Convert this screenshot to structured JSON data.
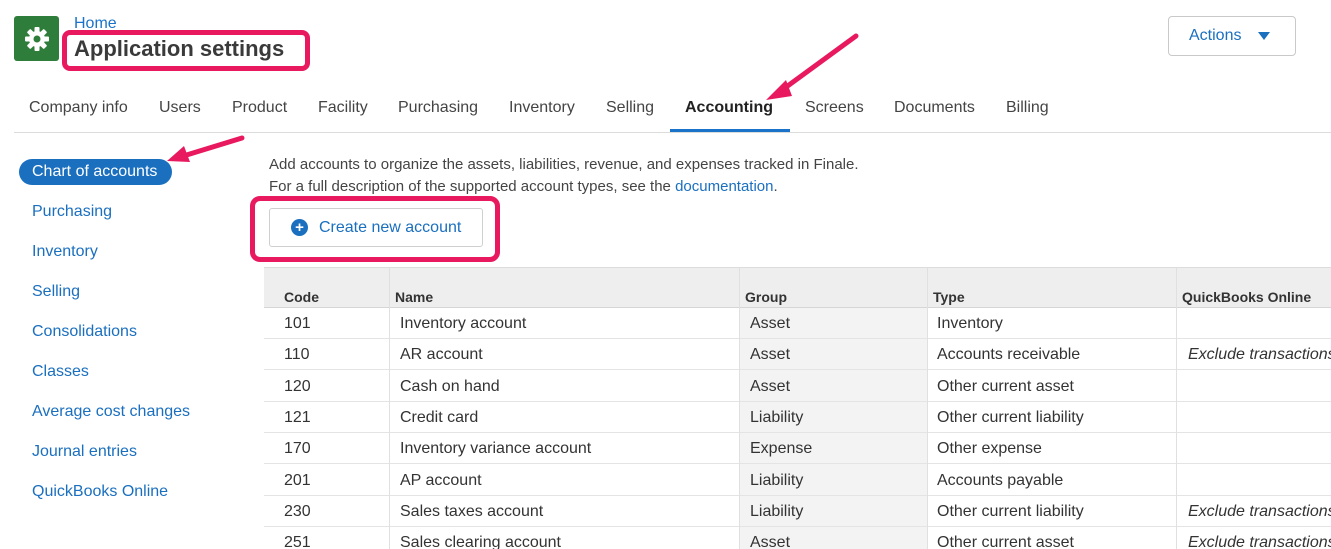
{
  "header": {
    "breadcrumb": "Home",
    "title": "Application settings",
    "actions_label": "Actions"
  },
  "tabs": [
    {
      "label": "Company info"
    },
    {
      "label": "Users"
    },
    {
      "label": "Product"
    },
    {
      "label": "Facility"
    },
    {
      "label": "Purchasing"
    },
    {
      "label": "Inventory"
    },
    {
      "label": "Selling"
    },
    {
      "label": "Accounting",
      "active": true
    },
    {
      "label": "Screens"
    },
    {
      "label": "Documents"
    },
    {
      "label": "Billing"
    }
  ],
  "sidebar": {
    "items": [
      {
        "label": "Chart of accounts",
        "active": true
      },
      {
        "label": "Purchasing"
      },
      {
        "label": "Inventory"
      },
      {
        "label": "Selling"
      },
      {
        "label": "Consolidations"
      },
      {
        "label": "Classes"
      },
      {
        "label": "Average cost changes"
      },
      {
        "label": "Journal entries"
      },
      {
        "label": "QuickBooks Online"
      }
    ]
  },
  "main": {
    "description_line1": "Add accounts to organize the assets, liabilities, revenue, and expenses tracked in Finale.",
    "description_line2_prefix": "For a full description of the supported account types, see the",
    "description_link": "documentation",
    "description_line2_suffix": ".",
    "create_button_label": "Create new account"
  },
  "table": {
    "columns": [
      "Code",
      "Name",
      "Group",
      "Type",
      "QuickBooks Online"
    ],
    "rows": [
      {
        "code": "101",
        "name": "Inventory account",
        "group": "Asset",
        "type": "Inventory",
        "qbo": ""
      },
      {
        "code": "110",
        "name": "AR account",
        "group": "Asset",
        "type": "Accounts receivable",
        "qbo": "Exclude transactions"
      },
      {
        "code": "120",
        "name": "Cash on hand",
        "group": "Asset",
        "type": "Other current asset",
        "qbo": ""
      },
      {
        "code": "121",
        "name": "Credit card",
        "group": "Liability",
        "type": "Other current liability",
        "qbo": ""
      },
      {
        "code": "170",
        "name": "Inventory variance account",
        "group": "Expense",
        "type": "Other expense",
        "qbo": ""
      },
      {
        "code": "201",
        "name": "AP account",
        "group": "Liability",
        "type": "Accounts payable",
        "qbo": ""
      },
      {
        "code": "230",
        "name": "Sales taxes account",
        "group": "Liability",
        "type": "Other current liability",
        "qbo": "Exclude transactions"
      },
      {
        "code": "251",
        "name": "Sales clearing account",
        "group": "Asset",
        "type": "Other current asset",
        "qbo": "Exclude transactions"
      }
    ]
  },
  "colors": {
    "accent": "#1a73c8",
    "highlight": "#e8195f",
    "app_icon": "#2e7d3a"
  },
  "icons": {
    "app": "gear-icon",
    "actions": "caret-down-icon",
    "create": "plus-circle-icon"
  }
}
